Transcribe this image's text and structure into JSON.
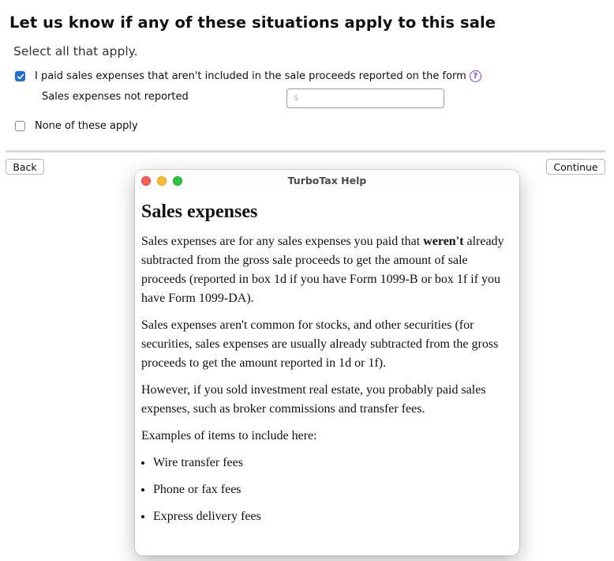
{
  "page": {
    "heading": "Let us know if any of these situations apply to this sale",
    "subheading": "Select all that apply."
  },
  "options": {
    "sales_expenses": {
      "label": "I paid sales expenses that aren't included in the sale proceeds reported on the form",
      "checked": true,
      "help_icon_glyph": "?",
      "sub_label": "Sales expenses not reported",
      "input_placeholder": "$",
      "input_value": ""
    },
    "none": {
      "label": "None of these apply",
      "checked": false
    }
  },
  "nav": {
    "back_label": "Back",
    "continue_label": "Continue"
  },
  "help_window": {
    "title": "TurboTax Help",
    "heading": "Sales expenses",
    "p1_before": "Sales expenses are for any sales expenses you paid that ",
    "p1_bold": "weren't",
    "p1_after": " already subtracted from the gross sale proceeds to get the amount of sale proceeds (reported in box 1d if you have Form 1099-B or box 1f if you have Form 1099-DA).",
    "p2": "Sales expenses aren't common for stocks, and other securities (for securities, sales expenses are usually already subtracted from the gross proceeds to get the amount reported in 1d or 1f).",
    "p3": "However, if you sold investment real estate, you probably paid sales expenses, such as broker commissions and transfer fees.",
    "p4": "Examples of items to include here:",
    "examples": [
      "Wire transfer fees",
      "Phone or fax fees",
      "Express delivery fees"
    ]
  },
  "colors": {
    "checkbox_checked": "#1f6fd1",
    "help_icon": "#7b3fe4",
    "close_button": "#ff5f57",
    "minimize_button": "#febc2e",
    "zoom_button": "#28c840"
  }
}
